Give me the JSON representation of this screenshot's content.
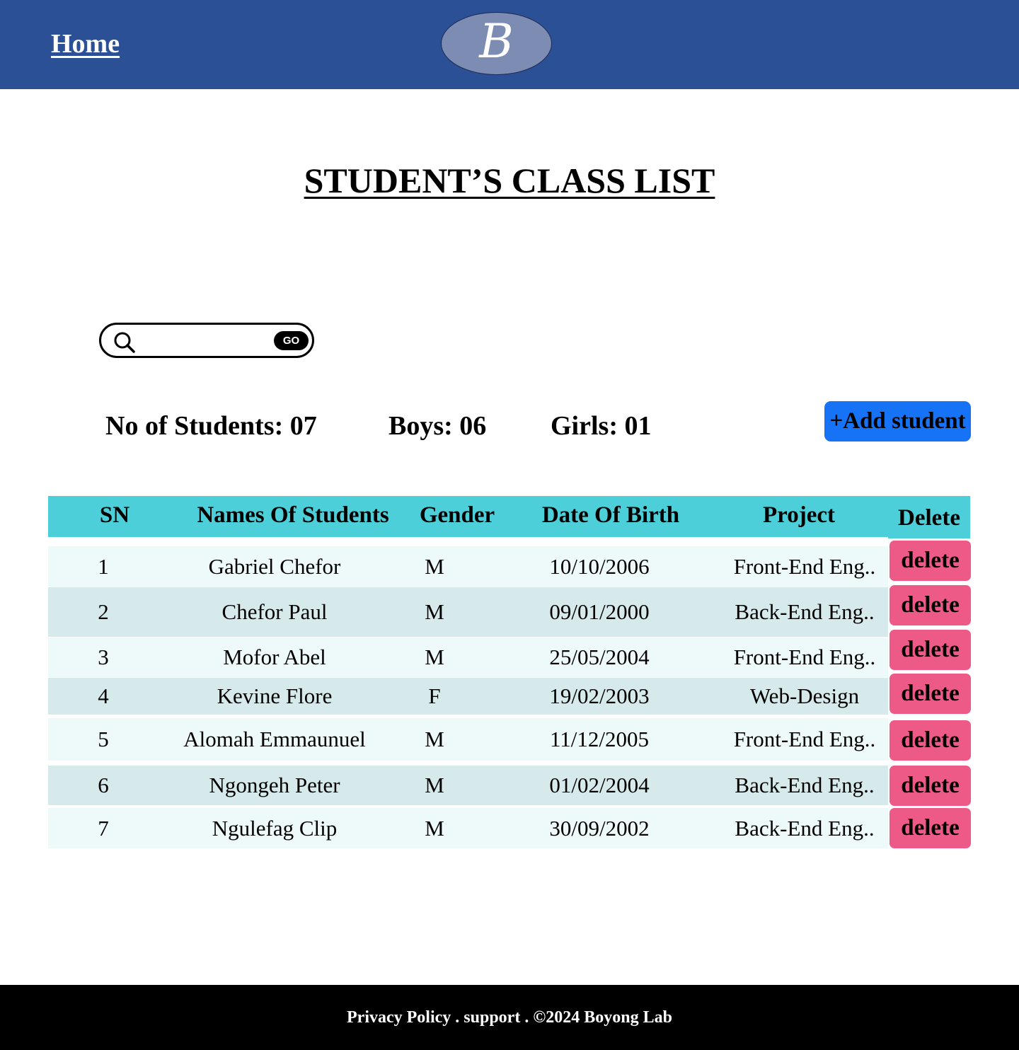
{
  "header": {
    "home_label": "Home",
    "logo_letter": "B"
  },
  "page_title": "STUDENT’S CLASS LIST",
  "search": {
    "placeholder": "",
    "go_label": "GO"
  },
  "stats": {
    "total": "No of Students: 07",
    "boys": "Boys: 06",
    "girls": "Girls: 01"
  },
  "add_button_label": "+Add student",
  "table": {
    "columns": [
      "SN",
      "Names Of Students",
      "Gender",
      "Date Of Birth",
      "Project",
      "Delete"
    ],
    "delete_label": "delete",
    "rows": [
      {
        "sn": "1",
        "name": "Gabriel Chefor",
        "gender": "M",
        "dob": "10/10/2006",
        "project": "Front-End Eng.."
      },
      {
        "sn": "2",
        "name": "Chefor Paul",
        "gender": "M",
        "dob": "09/01/2000",
        "project": "Back-End Eng.."
      },
      {
        "sn": "3",
        "name": "Mofor Abel",
        "gender": "M",
        "dob": "25/05/2004",
        "project": "Front-End Eng.."
      },
      {
        "sn": "4",
        "name": "Kevine Flore",
        "gender": "F",
        "dob": "19/02/2003",
        "project": "Web-Design"
      },
      {
        "sn": "5",
        "name": "Alomah Emmaunuel",
        "gender": "M",
        "dob": "11/12/2005",
        "project": "Front-End Eng.."
      },
      {
        "sn": "6",
        "name": "Ngongeh Peter",
        "gender": "M",
        "dob": "01/02/2004",
        "project": "Back-End Eng.."
      },
      {
        "sn": "7",
        "name": "Ngulefag Clip",
        "gender": "M",
        "dob": "30/09/2002",
        "project": "Back-End Eng.."
      }
    ]
  },
  "footer_text": "Privacy Policy . support . ©2024 Boyong Lab",
  "colors": {
    "header_bg": "#2c5096",
    "table_header_bg": "#4ccfd8",
    "add_button_bg": "#1673f5",
    "delete_button_bg": "#ee5a88",
    "footer_bg": "#000000"
  }
}
